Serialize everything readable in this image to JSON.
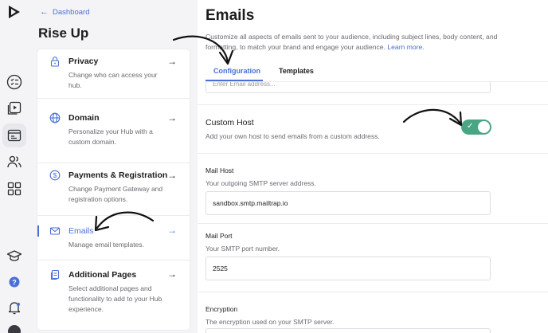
{
  "app": {
    "logo_icon": "play-logo",
    "rail_icons": [
      "checklist-icon",
      "video-play-icon",
      "browser-window-icon",
      "users-icon",
      "apps-grid-icon",
      "graduation-cap-icon",
      "help-icon",
      "notification-bell-icon"
    ]
  },
  "nav": {
    "back_label": "Dashboard",
    "hub_title": "Rise Up",
    "items": [
      {
        "icon": "lock-icon",
        "title": "Privacy",
        "desc": "Change who can access your hub."
      },
      {
        "icon": "globe-icon",
        "title": "Domain",
        "desc": "Personalize your Hub with a custom domain."
      },
      {
        "icon": "dollar-icon",
        "title": "Payments & Registration",
        "desc": "Change Payment Gateway and registration options."
      },
      {
        "icon": "envelope-icon",
        "title": "Emails",
        "desc": "Manage email templates.",
        "active": true
      },
      {
        "icon": "pages-icon",
        "title": "Additional Pages",
        "desc": "Select additional pages and functionality to add to your Hub experience."
      }
    ]
  },
  "main": {
    "title": "Emails",
    "intro": "Customize all aspects of emails sent to your audience, including subject lines, body content, and formatting, to match your brand and engage your audience.",
    "learn_more": "Learn more.",
    "tabs": [
      "Configuration",
      "Templates"
    ],
    "active_tab": "Configuration",
    "cutoff_placeholder": "Enter Email address...",
    "custom_host": {
      "label": "Custom Host",
      "desc": "Add your own host to send emails from a custom address.",
      "enabled": true
    },
    "mail_host": {
      "label": "Mail Host",
      "desc": "Your outgoing SMTP server address.",
      "value": "sandbox.smtp.mailtrap.io"
    },
    "mail_port": {
      "label": "Mail Port",
      "desc": "Your SMTP port number.",
      "value": "2525"
    },
    "encryption": {
      "label": "Encryption",
      "desc": "The encryption used on your SMTP server."
    }
  },
  "colors": {
    "accent": "#4a6fd8",
    "toggle_on": "#4aa584"
  }
}
